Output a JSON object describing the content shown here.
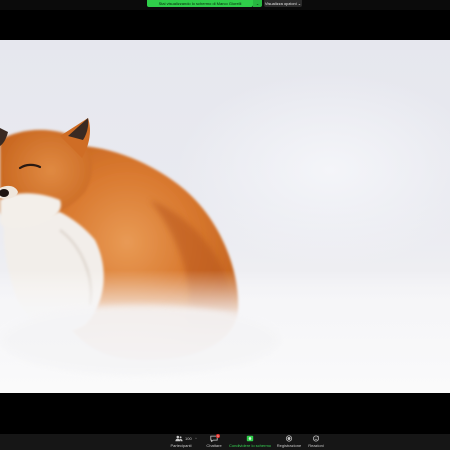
{
  "banner": {
    "share_status": "Stai visualizzando lo schermo di Marco Giorelli",
    "view_options": "Visualizza opzioni",
    "view_options_caret": "⌄",
    "share_caret": "⌄"
  },
  "toolbar": {
    "participants": {
      "label": "Partecipanti",
      "count": "100",
      "caret": "^"
    },
    "chat": {
      "label": "Chattare",
      "badge": "1"
    },
    "share_screen": {
      "label": "Condividere lo schermo"
    },
    "record": {
      "label": "Registrazione"
    },
    "reactions": {
      "label": "Reazioni"
    }
  },
  "colors": {
    "share_green": "#2fcf4a",
    "toolbar_bg": "#161616",
    "badge_red": "#e3342f"
  }
}
